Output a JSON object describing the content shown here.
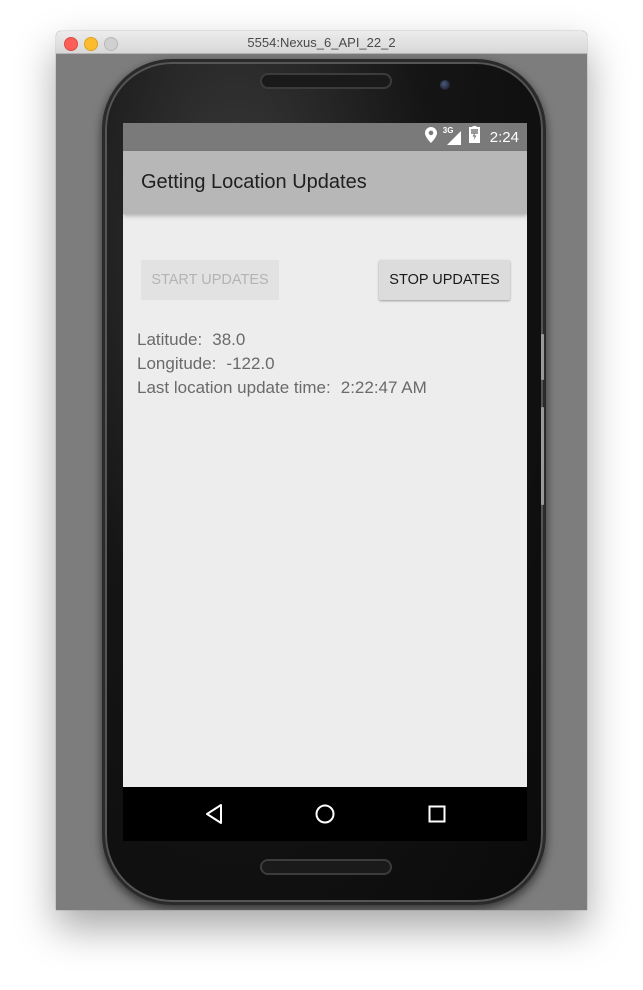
{
  "window": {
    "title": "5554:Nexus_6_API_22_2"
  },
  "statusbar": {
    "network_label": "3G",
    "time": "2:24",
    "icons": [
      "location-icon",
      "signal-icon",
      "battery-icon"
    ]
  },
  "app": {
    "title": "Getting Location Updates"
  },
  "buttons": {
    "start_label": "START UPDATES",
    "start_enabled": false,
    "stop_label": "STOP UPDATES",
    "stop_enabled": true
  },
  "location": {
    "latitude_label": "Latitude:",
    "latitude_value": "38.0",
    "longitude_label": "Longitude:",
    "longitude_value": "-122.0",
    "time_label": "Last location update time:",
    "time_value": "2:22:47 AM"
  },
  "navbar": {
    "icons": [
      "back-icon",
      "home-icon",
      "recents-icon"
    ]
  },
  "colors": {
    "statusbar": "#7a7a7a",
    "appbar": "#b7b7b7",
    "content_bg": "#ededed",
    "window_bg": "#7d7d7d"
  }
}
